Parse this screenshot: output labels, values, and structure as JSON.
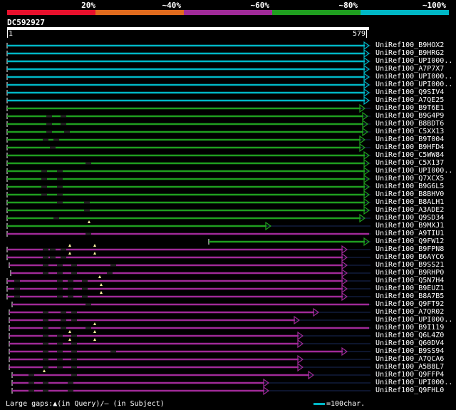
{
  "legend": {
    "labels": [
      "20%",
      "~40%",
      "~60%",
      "~80%",
      "~100%"
    ],
    "colors": [
      "#e8102c",
      "#e06a1d",
      "#a02a98",
      "#1f9e1f",
      "#00b7c6"
    ]
  },
  "query": {
    "id": "DC592927",
    "start": "1",
    "end": "579"
  },
  "hits": [
    {
      "label": "UniRef100_B9HOX2",
      "class": 5,
      "start": 10,
      "end": 518,
      "gaps": [],
      "arrow": true
    },
    {
      "label": "UniRef100_B9HRG2",
      "class": 5,
      "start": 10,
      "end": 518,
      "gaps": [],
      "arrow": true
    },
    {
      "label": "UniRef100_UPI000..",
      "class": 5,
      "start": 10,
      "end": 518,
      "gaps": [],
      "arrow": true
    },
    {
      "label": "UniRef100_A7P7X7",
      "class": 5,
      "start": 10,
      "end": 518,
      "gaps": [],
      "arrow": true
    },
    {
      "label": "UniRef100_UPI000..",
      "class": 5,
      "start": 10,
      "end": 518,
      "gaps": [],
      "arrow": true
    },
    {
      "label": "UniRef100_UPI000..",
      "class": 5,
      "start": 10,
      "end": 518,
      "gaps": [],
      "arrow": true
    },
    {
      "label": "UniRef100_Q9SIV4",
      "class": 5,
      "start": 10,
      "end": 518,
      "gaps": [],
      "arrow": true
    },
    {
      "label": "UniRef100_A7QE25",
      "class": 5,
      "start": 10,
      "end": 518,
      "gaps": [],
      "arrow": true
    },
    {
      "label": "UniRef100_B9T6E1",
      "class": 4,
      "start": 10,
      "end": 512,
      "gaps": [],
      "arrow": true
    },
    {
      "label": "UniRef100_B9G4P9",
      "class": 4,
      "start": 10,
      "end": 516,
      "gaps": [
        65,
        85
      ],
      "arrow": true
    },
    {
      "label": "UniRef100_B8BDT6",
      "class": 4,
      "start": 10,
      "end": 516,
      "gaps": [
        65,
        85
      ],
      "arrow": true
    },
    {
      "label": "UniRef100_C5XX13",
      "class": 4,
      "start": 10,
      "end": 516,
      "gaps": [
        65,
        90
      ],
      "arrow": true
    },
    {
      "label": "UniRef100_B9T004",
      "class": 4,
      "start": 10,
      "end": 512,
      "gaps": [
        60,
        75
      ],
      "arrow": true
    },
    {
      "label": "UniRef100_B9HFD4",
      "class": 4,
      "start": 10,
      "end": 512,
      "gaps": [
        70
      ],
      "arrow": true
    },
    {
      "label": "UniRef100_C5WW84",
      "class": 4,
      "start": 10,
      "end": 518,
      "gaps": [],
      "arrow": true
    },
    {
      "label": "UniRef100_C5X137",
      "class": 4,
      "start": 10,
      "end": 518,
      "gaps": [
        120
      ],
      "arrow": true
    },
    {
      "label": "UniRef100_UPI000..",
      "class": 4,
      "start": 10,
      "end": 518,
      "gaps": [
        58,
        80
      ],
      "arrow": true
    },
    {
      "label": "UniRef100_Q7XCX5",
      "class": 4,
      "start": 10,
      "end": 518,
      "gaps": [
        58,
        80
      ],
      "arrow": true
    },
    {
      "label": "UniRef100_B9G6L5",
      "class": 4,
      "start": 10,
      "end": 518,
      "gaps": [
        58,
        80
      ],
      "arrow": true
    },
    {
      "label": "UniRef100_B8BHV0",
      "class": 4,
      "start": 10,
      "end": 518,
      "gaps": [
        58,
        80
      ],
      "arrow": true
    },
    {
      "label": "UniRef100_B8ALH1",
      "class": 4,
      "start": 10,
      "end": 518,
      "gaps": [
        80,
        118
      ],
      "arrow": true
    },
    {
      "label": "UniRef100_A3ADE2",
      "class": 4,
      "start": 10,
      "end": 518,
      "gaps": [
        118
      ],
      "arrow": true
    },
    {
      "label": "UniRef100_Q9SD34",
      "class": 4,
      "start": 10,
      "end": 512,
      "gaps": [
        75
      ],
      "arrow": true
    },
    {
      "label": "UniRef100_B9MXJ1",
      "class": 4,
      "start": 10,
      "end": 380,
      "gaps": [],
      "arrow": true,
      "ins": [
        125
      ]
    },
    {
      "label": "UniRef100_A9TIU1",
      "class": 3,
      "start": 10,
      "end": 518,
      "gaps": [
        120
      ],
      "arrow": false
    },
    {
      "label": "UniRef100_Q9FW12",
      "class": 4,
      "start": 293,
      "end": 518,
      "gaps": [],
      "arrow": true
    },
    {
      "label": "UniRef100_B9FPN8",
      "class": 3,
      "start": 10,
      "end": 487,
      "gaps": [
        60,
        70,
        85
      ],
      "arrow": true,
      "ins": [
        98,
        133
      ]
    },
    {
      "label": "UniRef100_B6AYC6",
      "class": 3,
      "start": 10,
      "end": 487,
      "gaps": [
        60,
        70,
        85
      ],
      "arrow": true,
      "ins": [
        98,
        133
      ]
    },
    {
      "label": "UniRef100_B9SS21",
      "class": 3,
      "start": 13,
      "end": 487,
      "gaps": [
        60,
        80,
        100,
        155
      ],
      "arrow": true
    },
    {
      "label": "UniRef100_B9RHP0",
      "class": 3,
      "start": 15,
      "end": 487,
      "gaps": [
        60,
        80,
        100,
        150
      ],
      "arrow": true
    },
    {
      "label": "UniRef100_Q5N7H4",
      "class": 3,
      "start": 10,
      "end": 487,
      "gaps": [
        20,
        80,
        95,
        115
      ],
      "arrow": true,
      "ins": [
        140
      ]
    },
    {
      "label": "UniRef100_B9EUZ1",
      "class": 3,
      "start": 10,
      "end": 487,
      "gaps": [
        20,
        80,
        95,
        115
      ],
      "arrow": true,
      "ins": [
        142
      ]
    },
    {
      "label": "UniRef100_B8A7B5",
      "class": 3,
      "start": 10,
      "end": 487,
      "gaps": [
        20,
        80,
        95,
        115
      ],
      "arrow": true,
      "ins": [
        142
      ]
    },
    {
      "label": "UniRef100_Q9FT92",
      "class": 3,
      "start": 17,
      "end": 518,
      "gaps": [
        120
      ],
      "arrow": false
    },
    {
      "label": "UniRef100_A7QR02",
      "class": 3,
      "start": 13,
      "end": 447,
      "gaps": [
        60,
        85,
        100
      ],
      "arrow": true
    },
    {
      "label": "UniRef100_UPI000..",
      "class": 3,
      "start": 13,
      "end": 420,
      "gaps": [
        60,
        85,
        100
      ],
      "arrow": true
    },
    {
      "label": "UniRef100_B9I119",
      "class": 3,
      "start": 13,
      "end": 518,
      "gaps": [
        60,
        85,
        120
      ],
      "arrow": false,
      "ins": [
        133
      ]
    },
    {
      "label": "UniRef100_Q6L4Z0",
      "class": 3,
      "start": 13,
      "end": 425,
      "gaps": [
        60,
        80,
        100
      ],
      "arrow": true,
      "ins": [
        98,
        133
      ]
    },
    {
      "label": "UniRef100_Q60DV4",
      "class": 3,
      "start": 13,
      "end": 425,
      "gaps": [
        60,
        80,
        100
      ],
      "arrow": true,
      "ins": [
        98,
        133
      ]
    },
    {
      "label": "UniRef100_B9SS94",
      "class": 3,
      "start": 13,
      "end": 487,
      "gaps": [
        60,
        80,
        100,
        155
      ],
      "arrow": true
    },
    {
      "label": "UniRef100_A7QCA6",
      "class": 3,
      "start": 13,
      "end": 425,
      "gaps": [
        60,
        80,
        100
      ],
      "arrow": true
    },
    {
      "label": "UniRef100_A5B8L7",
      "class": 3,
      "start": 13,
      "end": 425,
      "gaps": [
        60,
        80,
        100
      ],
      "arrow": true
    },
    {
      "label": "UniRef100_Q9FFP4",
      "class": 3,
      "start": 17,
      "end": 440,
      "gaps": [
        40,
        100
      ],
      "arrow": true,
      "ins": [
        62
      ]
    },
    {
      "label": "UniRef100_UPI000..",
      "class": 3,
      "start": 17,
      "end": 377,
      "gaps": [
        40,
        60,
        95
      ],
      "arrow": true
    },
    {
      "label": "UniRef100_Q9FHL0",
      "class": 3,
      "start": 17,
      "end": 377,
      "gaps": [
        40,
        60,
        95
      ],
      "arrow": true
    }
  ],
  "footer": {
    "gaps_text": "Large gaps:▲(in Query)/– (in Subject)",
    "scale_text": "=100char."
  }
}
